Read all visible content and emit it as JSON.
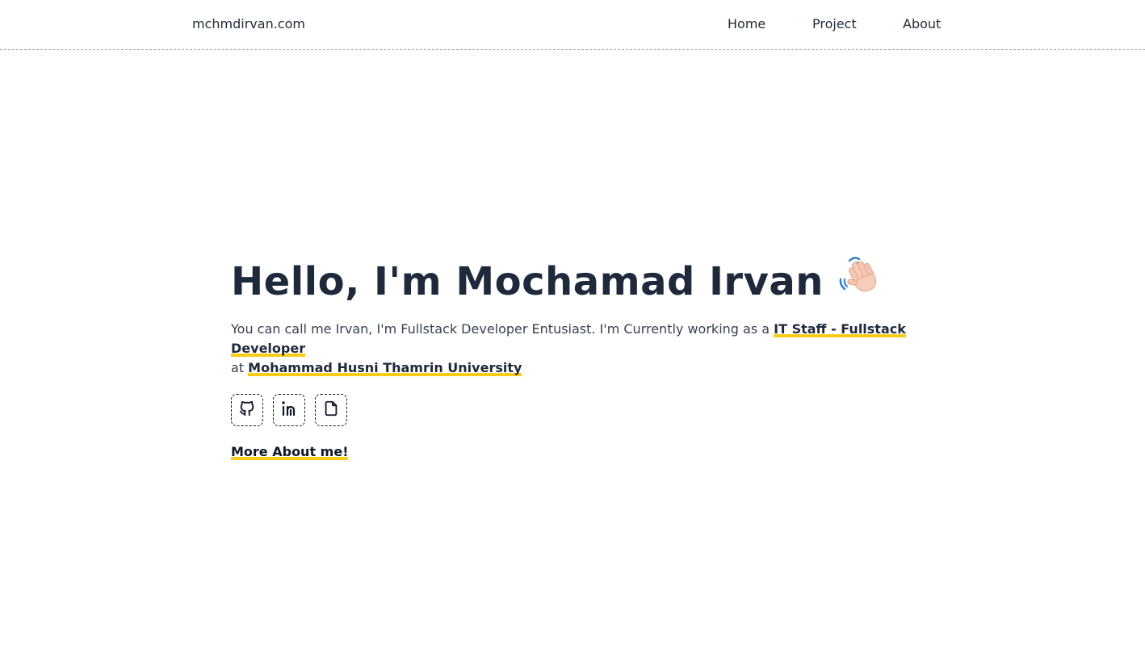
{
  "header": {
    "brand": "mchmdirvan.com",
    "nav": {
      "home": "Home",
      "project": "Project",
      "about": "About"
    }
  },
  "hero": {
    "title": "Hello, I'm Mochamad Irvan",
    "intro_prefix": "You can call me Irvan, I'm Fullstack Developer Entusiast. I'm Currently working as a ",
    "role": "IT Staff - Fullstack Developer",
    "intro_at": " at ",
    "company": "Mohammad Husni Thamrin University",
    "social_icons": [
      "github-icon",
      "linkedin-icon",
      "document-icon"
    ],
    "more_link": "More About me!"
  },
  "colors": {
    "accent_underline": "#facc15",
    "text_dark": "#1e293b",
    "divider": "#9ca3af"
  }
}
